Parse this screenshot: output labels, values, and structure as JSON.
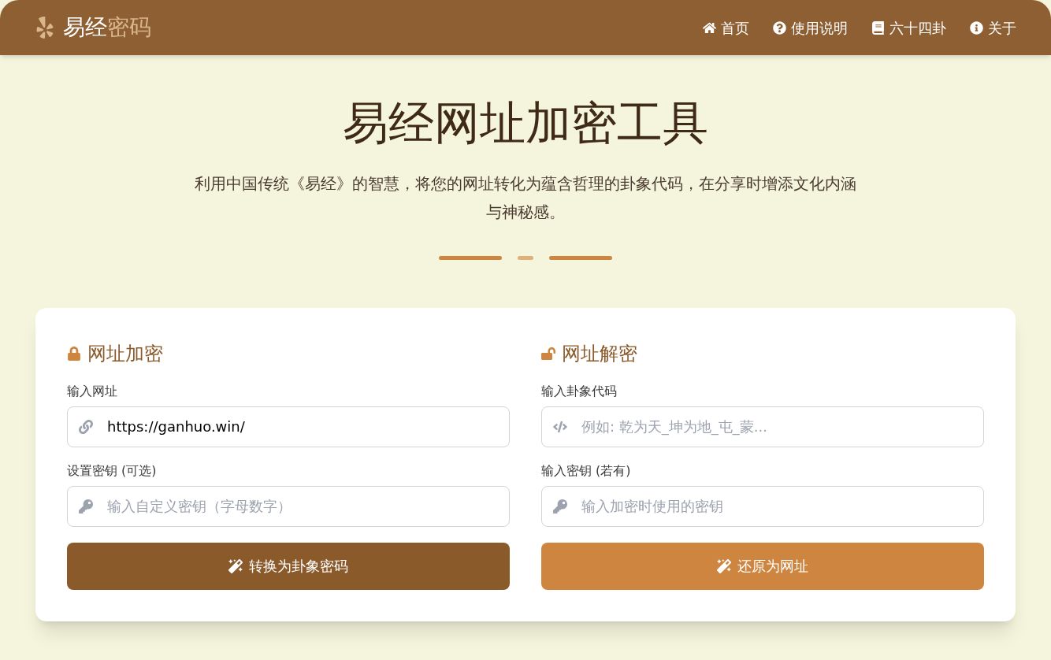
{
  "brand": {
    "main": "易经",
    "accent": "密码"
  },
  "nav": [
    {
      "kind": "home",
      "label": "首页"
    },
    {
      "kind": "help",
      "label": "使用说明"
    },
    {
      "kind": "book",
      "label": "六十四卦"
    },
    {
      "kind": "info",
      "label": "关于"
    }
  ],
  "hero": {
    "title": "易经网址加密工具",
    "subtitle": "利用中国传统《易经》的智慧，将您的网址转化为蕴含哲理的卦象代码，在分享时增添文化内涵与神秘感。"
  },
  "panels": [
    {
      "kind": "encrypt",
      "title": "网址加密",
      "fields": [
        {
          "kind": "link",
          "label": "输入网址",
          "value": "https://ganhuo.win/"
        },
        {
          "kind": "key",
          "label": "设置密钥 (可选)",
          "placeholder": "输入自定义密钥（字母数字）"
        }
      ],
      "button": "转换为卦象密码"
    },
    {
      "kind": "decrypt",
      "title": "网址解密",
      "fields": [
        {
          "kind": "code",
          "label": "输入卦象代码",
          "placeholder": "例如: 乾为天_坤为地_屯_蒙..."
        },
        {
          "kind": "key",
          "label": "输入密钥 (若有)",
          "placeholder": "输入加密时使用的密钥"
        }
      ],
      "button": "还原为网址"
    }
  ]
}
